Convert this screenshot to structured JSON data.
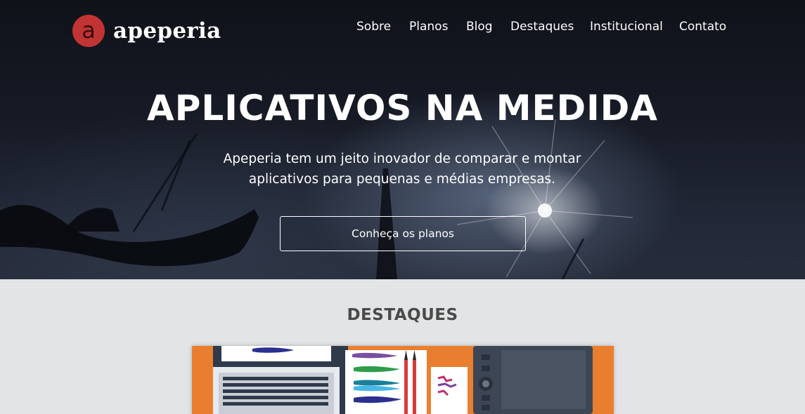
{
  "brand": {
    "name": "apeperia",
    "mark_letter": "a",
    "mark_color": "#c23434"
  },
  "nav": {
    "items": [
      {
        "label": "Sobre"
      },
      {
        "label": "Planos"
      },
      {
        "label": "Blog"
      },
      {
        "label": "Destaques"
      },
      {
        "label": "Institucional"
      },
      {
        "label": "Contato"
      }
    ]
  },
  "hero": {
    "title": "APLICATIVOS NA MEDIDA",
    "subtitle_line1": "Apeperia tem um jeito inovador de comparar e montar",
    "subtitle_line2": "aplicativos para pequenas e médias empresas.",
    "cta_label": "Conheça os planos"
  },
  "highlights": {
    "title": "DESTAQUES",
    "feature_image": "designer-desk-illustration",
    "accent_color": "#e97f2e"
  }
}
